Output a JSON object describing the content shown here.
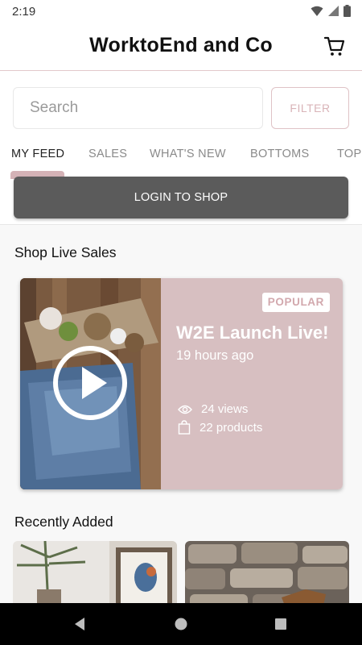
{
  "status_bar": {
    "time": "2:19"
  },
  "header": {
    "title": "WorktoEnd and Co"
  },
  "search": {
    "placeholder": "Search",
    "filter_label": "FILTER"
  },
  "tabs": [
    {
      "label": "MY FEED"
    },
    {
      "label": "SALES"
    },
    {
      "label": "WHAT'S NEW"
    },
    {
      "label": "BOTTOMS"
    },
    {
      "label": "TOP"
    }
  ],
  "login": {
    "label": "LOGIN TO SHOP"
  },
  "live_section": {
    "title": "Shop Live Sales",
    "card": {
      "badge": "POPULAR",
      "title": "W2E Launch Live!",
      "time": "19 hours ago",
      "views": "24 views",
      "products": "22 products"
    }
  },
  "recent_section": {
    "title": "Recently Added"
  },
  "colors": {
    "accent_pink": "#d7bfc1",
    "login_gray": "#5b5b5b",
    "filter_text": "#d9b4b8"
  }
}
